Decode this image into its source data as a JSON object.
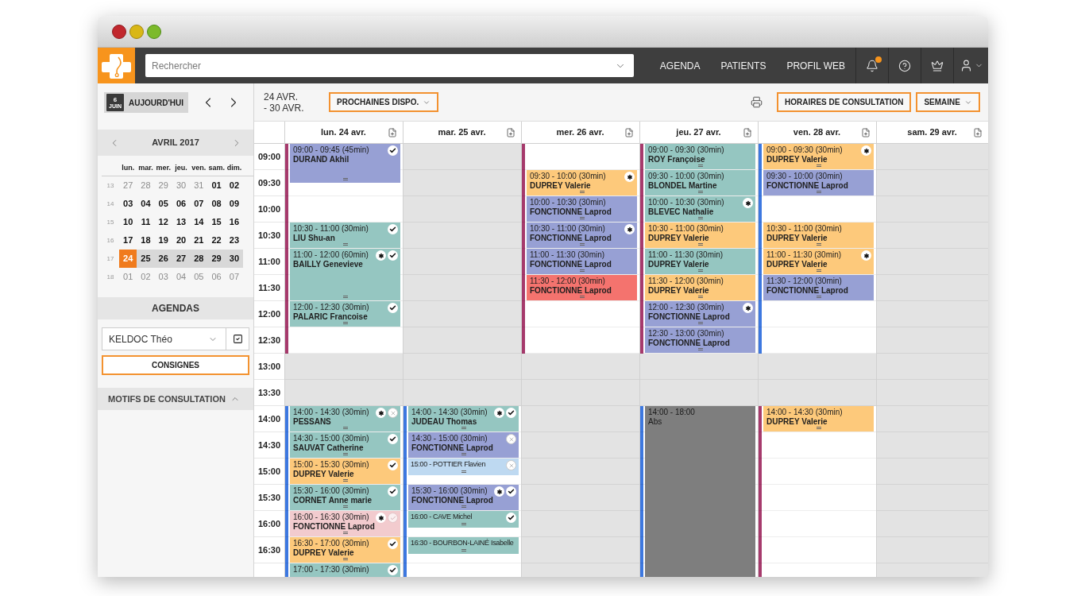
{
  "nav": {
    "search": {
      "placeholder": "Rechercher"
    },
    "links": [
      "AGENDA",
      "PATIENTS",
      "PROFIL WEB"
    ],
    "notifications_unread": true
  },
  "sidebar_toolbar": {
    "today_button": {
      "label": "AUJOURD'HUI",
      "badge_day": "6",
      "badge_month": "JUIN"
    }
  },
  "mini_calendar": {
    "title": "AVRIL 2017",
    "weekdays": [
      "lun.",
      "mar.",
      "mer.",
      "jeu.",
      "ven.",
      "sam.",
      "dim."
    ],
    "weeks": [
      {
        "number": "13",
        "days": [
          {
            "label": "27",
            "muted": true,
            "in_range": false,
            "selected": false
          },
          {
            "label": "28",
            "muted": true,
            "in_range": false,
            "selected": false
          },
          {
            "label": "29",
            "muted": true,
            "in_range": false,
            "selected": false
          },
          {
            "label": "30",
            "muted": true,
            "in_range": false,
            "selected": false
          },
          {
            "label": "31",
            "muted": true,
            "in_range": false,
            "selected": false
          },
          {
            "label": "01",
            "muted": false,
            "in_range": false,
            "selected": false
          },
          {
            "label": "02",
            "muted": false,
            "in_range": false,
            "selected": false
          }
        ]
      },
      {
        "number": "14",
        "days": [
          {
            "label": "03",
            "muted": false,
            "in_range": false,
            "selected": false
          },
          {
            "label": "04",
            "muted": false,
            "in_range": false,
            "selected": false
          },
          {
            "label": "05",
            "muted": false,
            "in_range": false,
            "selected": false
          },
          {
            "label": "06",
            "muted": false,
            "in_range": false,
            "selected": false
          },
          {
            "label": "07",
            "muted": false,
            "in_range": false,
            "selected": false
          },
          {
            "label": "08",
            "muted": false,
            "in_range": false,
            "selected": false
          },
          {
            "label": "09",
            "muted": false,
            "in_range": false,
            "selected": false
          }
        ]
      },
      {
        "number": "15",
        "days": [
          {
            "label": "10",
            "muted": false,
            "in_range": false,
            "selected": false
          },
          {
            "label": "11",
            "muted": false,
            "in_range": false,
            "selected": false
          },
          {
            "label": "12",
            "muted": false,
            "in_range": false,
            "selected": false
          },
          {
            "label": "13",
            "muted": false,
            "in_range": false,
            "selected": false
          },
          {
            "label": "14",
            "muted": false,
            "in_range": false,
            "selected": false
          },
          {
            "label": "15",
            "muted": false,
            "in_range": false,
            "selected": false
          },
          {
            "label": "16",
            "muted": false,
            "in_range": false,
            "selected": false
          }
        ]
      },
      {
        "number": "16",
        "days": [
          {
            "label": "17",
            "muted": false,
            "in_range": false,
            "selected": false
          },
          {
            "label": "18",
            "muted": false,
            "in_range": false,
            "selected": false
          },
          {
            "label": "19",
            "muted": false,
            "in_range": false,
            "selected": false
          },
          {
            "label": "20",
            "muted": false,
            "in_range": false,
            "selected": false
          },
          {
            "label": "21",
            "muted": false,
            "in_range": false,
            "selected": false
          },
          {
            "label": "22",
            "muted": false,
            "in_range": false,
            "selected": false
          },
          {
            "label": "23",
            "muted": false,
            "in_range": false,
            "selected": false
          }
        ]
      },
      {
        "number": "17",
        "days": [
          {
            "label": "24",
            "muted": false,
            "in_range": true,
            "selected": true
          },
          {
            "label": "25",
            "muted": false,
            "in_range": true,
            "selected": false
          },
          {
            "label": "26",
            "muted": false,
            "in_range": true,
            "selected": false
          },
          {
            "label": "27",
            "muted": false,
            "in_range": true,
            "selected": false
          },
          {
            "label": "28",
            "muted": false,
            "in_range": true,
            "selected": false
          },
          {
            "label": "29",
            "muted": false,
            "in_range": true,
            "selected": false
          },
          {
            "label": "30",
            "muted": false,
            "in_range": true,
            "selected": false
          }
        ]
      },
      {
        "number": "18",
        "days": [
          {
            "label": "01",
            "muted": true,
            "in_range": false,
            "selected": false
          },
          {
            "label": "02",
            "muted": true,
            "in_range": false,
            "selected": false
          },
          {
            "label": "03",
            "muted": true,
            "in_range": false,
            "selected": false
          },
          {
            "label": "04",
            "muted": true,
            "in_range": false,
            "selected": false
          },
          {
            "label": "05",
            "muted": true,
            "in_range": false,
            "selected": false
          },
          {
            "label": "06",
            "muted": true,
            "in_range": false,
            "selected": false
          },
          {
            "label": "07",
            "muted": true,
            "in_range": false,
            "selected": false
          }
        ]
      }
    ]
  },
  "agendas": {
    "title": "AGENDAS",
    "select_value": "KELDOC Théo",
    "checked": true,
    "instructions_button": "CONSIGNES"
  },
  "motifs": {
    "title": "MOTIFS DE CONSULTATION",
    "expanded": true
  },
  "toolbar": {
    "date_range": [
      "24 AVR.",
      "- 30 AVR."
    ],
    "next_available_button": "PROCHAINES DISPO.",
    "hours_button": "HORAIRES DE CONSULTATION",
    "view_select": "SEMAINE"
  },
  "calendar": {
    "times": [
      "09:00",
      "09:30",
      "10:00",
      "10:30",
      "11:00",
      "11:30",
      "12:00",
      "12:30",
      "13:00",
      "13:30",
      "14:00",
      "14:30",
      "15:00",
      "15:30",
      "16:00",
      "16:30"
    ],
    "days": [
      {
        "label": "lun. 24 avr.",
        "sessions": [
          {
            "kind": "morning",
            "color": "#a63a6c"
          },
          {
            "kind": "afternoon",
            "color": "#3d78e0"
          }
        ],
        "events": [
          {
            "kind": "appointment",
            "color": "#97a0d4",
            "time": "09:00 - 09:45 (45min)",
            "name": "DURAND Akhil",
            "icons": [
              {
                "kind": "check"
              }
            ]
          },
          {
            "kind": "appointment",
            "color": "#95c6c1",
            "time": "10:30 - 11:00 (30min)",
            "name": "LIU Shu-an",
            "icons": [
              {
                "kind": "check"
              }
            ]
          },
          {
            "kind": "appointment",
            "color": "#95c6c1",
            "time": "11:00 - 12:00 (60min)",
            "name": "BAILLY Genevieve",
            "icons": [
              {
                "kind": "asterisk"
              },
              {
                "kind": "check"
              }
            ]
          },
          {
            "kind": "appointment",
            "color": "#95c6c1",
            "time": "12:00 - 12:30 (30min)",
            "name": "PALARIC Francoise",
            "icons": [
              {
                "kind": "check"
              }
            ]
          },
          {
            "kind": "appointment",
            "color": "#95c6c1",
            "time": "14:00 - 14:30 (30min)",
            "name": "PESSANS",
            "icons": [
              {
                "kind": "asterisk"
              },
              {
                "kind": "cross"
              }
            ]
          },
          {
            "kind": "appointment",
            "color": "#95c6c1",
            "time": "14:30 - 15:00 (30min)",
            "name": "SAUVAT Catherine",
            "icons": [
              {
                "kind": "check"
              }
            ]
          },
          {
            "kind": "appointment",
            "color": "#fdc97b",
            "time": "15:00 - 15:30 (30min)",
            "name": "DUPREY Valerie",
            "icons": [
              {
                "kind": "check"
              }
            ]
          },
          {
            "kind": "appointment",
            "color": "#95c6c1",
            "time": "15:30 - 16:00 (30min)",
            "name": "CORNET Anne marie",
            "icons": [
              {
                "kind": "check"
              }
            ]
          },
          {
            "kind": "appointment",
            "color": "#f2cbce",
            "time": "16:00 - 16:30 (30min)",
            "name": "FONCTIONNE Laprod",
            "icons": [
              {
                "kind": "asterisk"
              },
              {
                "kind": "faded"
              }
            ]
          },
          {
            "kind": "appointment",
            "color": "#fdc97b",
            "time": "16:30 - 17:00 (30min)",
            "name": "DUPREY Valerie",
            "icons": [
              {
                "kind": "check"
              }
            ]
          },
          {
            "kind": "appointment",
            "color": "#95c6c1",
            "time": "17:00 - 17:30 (30min)",
            "icons": [
              {
                "kind": "check"
              }
            ]
          }
        ]
      },
      {
        "label": "mar. 25 avr.",
        "sessions": [
          {
            "kind": "afternoon",
            "color": "#3d78e0"
          }
        ],
        "events": [
          {
            "kind": "appointment",
            "color": "#95c6c1",
            "time": "14:00 - 14:30 (30min)",
            "name": "JUDEAU Thomas",
            "icons": [
              {
                "kind": "asterisk"
              },
              {
                "kind": "check"
              }
            ]
          },
          {
            "kind": "appointment",
            "color": "#97a0d4",
            "time": "14:30 - 15:00 (30min)",
            "name": "FONCTIONNE Laprod",
            "icons": [
              {
                "kind": "cross"
              }
            ]
          },
          {
            "kind": "compact",
            "color": "#bed9f1",
            "label": "15:00 - POTTIER Flavien",
            "icons": [
              {
                "kind": "cross"
              }
            ]
          },
          {
            "kind": "appointment",
            "color": "#97a0d4",
            "time": "15:30 - 16:00 (30min)",
            "name": "FONCTIONNE Laprod",
            "icons": [
              {
                "kind": "asterisk"
              },
              {
                "kind": "check"
              }
            ]
          },
          {
            "kind": "compact",
            "color": "#95c6c1",
            "label": "16:00 - CAVE Michel",
            "icons": [
              {
                "kind": "check"
              }
            ]
          },
          {
            "kind": "compact",
            "color": "#95c6c1",
            "label": "16:30 - BOURBON-LAINÉ Isabelle"
          }
        ]
      },
      {
        "label": "mer. 26 avr.",
        "sessions": [
          {
            "kind": "morning",
            "color": "#a63a6c"
          }
        ],
        "events": [
          {
            "kind": "appointment",
            "color": "#fdc97b",
            "time": "09:30 - 10:00 (30min)",
            "name": "DUPREY Valerie",
            "icons": [
              {
                "kind": "asterisk"
              }
            ]
          },
          {
            "kind": "appointment",
            "color": "#97a0d4",
            "time": "10:00 - 10:30 (30min)",
            "name": "FONCTIONNE Laprod"
          },
          {
            "kind": "appointment",
            "color": "#97a0d4",
            "time": "10:30 - 11:00 (30min)",
            "name": "FONCTIONNE Laprod",
            "icons": [
              {
                "kind": "asterisk"
              }
            ]
          },
          {
            "kind": "appointment",
            "color": "#97a0d4",
            "time": "11:00 - 11:30 (30min)",
            "name": "FONCTIONNE Laprod"
          },
          {
            "kind": "appointment",
            "color": "#f4736e",
            "time": "11:30 - 12:00 (30min)",
            "name": "FONCTIONNE Laprod"
          }
        ]
      },
      {
        "label": "jeu. 27 avr.",
        "sessions": [
          {
            "kind": "morning",
            "color": "#a63a6c"
          },
          {
            "kind": "afternoon",
            "color": "#3d78e0"
          }
        ],
        "events": [
          {
            "kind": "appointment",
            "color": "#95c6c1",
            "time": "09:00 - 09:30 (30min)",
            "name": "ROY Françoise"
          },
          {
            "kind": "appointment",
            "color": "#95c6c1",
            "time": "09:30 - 10:00 (30min)",
            "name": "BLONDEL Martine"
          },
          {
            "kind": "appointment",
            "color": "#95c6c1",
            "time": "10:00 - 10:30 (30min)",
            "name": "BLEVEC Nathalie",
            "icons": [
              {
                "kind": "asterisk"
              }
            ]
          },
          {
            "kind": "appointment",
            "color": "#fdc97b",
            "time": "10:30 - 11:00 (30min)",
            "name": "DUPREY Valerie"
          },
          {
            "kind": "appointment",
            "color": "#95c6c1",
            "time": "11:00 - 11:30 (30min)",
            "name": "DUPREY Valerie"
          },
          {
            "kind": "appointment",
            "color": "#fdc97b",
            "time": "11:30 - 12:00 (30min)",
            "name": "DUPREY Valerie"
          },
          {
            "kind": "appointment",
            "color": "#97a0d4",
            "time": "12:00 - 12:30 (30min)",
            "name": "FONCTIONNE Laprod",
            "icons": [
              {
                "kind": "asterisk"
              }
            ]
          },
          {
            "kind": "appointment",
            "color": "#97a0d4",
            "time": "12:30 - 13:00 (30min)",
            "name": "FONCTIONNE Laprod"
          },
          {
            "kind": "absence",
            "color": "#7e7e7e",
            "time": "14:00 - 18:00",
            "name": "Abs"
          }
        ]
      },
      {
        "label": "ven. 28 avr.",
        "sessions": [
          {
            "kind": "morning",
            "color": "#3d78e0"
          },
          {
            "kind": "afternoon",
            "color": "#a63a6c"
          }
        ],
        "events": [
          {
            "kind": "appointment",
            "color": "#fdc97b",
            "time": "09:00 - 09:30 (30min)",
            "name": "DUPREY Valerie",
            "icons": [
              {
                "kind": "asterisk"
              }
            ]
          },
          {
            "kind": "appointment",
            "color": "#97a0d4",
            "time": "09:30 - 10:00 (30min)",
            "name": "FONCTIONNE Laprod"
          },
          {
            "kind": "appointment",
            "color": "#fdc97b",
            "time": "10:30 - 11:00 (30min)",
            "name": "DUPREY Valerie"
          },
          {
            "kind": "appointment",
            "color": "#fdc97b",
            "time": "11:00 - 11:30 (30min)",
            "name": "DUPREY Valerie",
            "icons": [
              {
                "kind": "asterisk"
              }
            ]
          },
          {
            "kind": "appointment",
            "color": "#97a0d4",
            "time": "11:30 - 12:00 (30min)",
            "name": "FONCTIONNE Laprod"
          },
          {
            "kind": "appointment",
            "color": "#fdc97b",
            "time": "14:00 - 14:30 (30min)",
            "name": "DUPREY Valerie"
          }
        ]
      },
      {
        "label": "sam. 29 avr."
      }
    ]
  }
}
